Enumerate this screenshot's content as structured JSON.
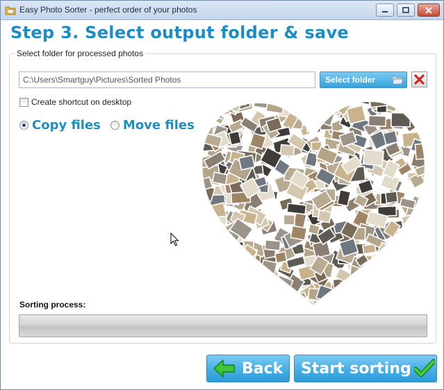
{
  "window": {
    "title": "Easy Photo Sorter - perfect order of your photos"
  },
  "step": {
    "heading": "Step 3. Select output folder & save"
  },
  "output_group": {
    "legend": "Select folder for processed photos",
    "folder_path": "C:\\Users\\Smartguy\\Pictures\\Sorted Photos",
    "select_folder_label": "Select folder",
    "shortcut_label": "Create shortcut on desktop",
    "shortcut_checked": false,
    "mode_options": [
      "Copy files",
      "Move files"
    ],
    "selected_mode": "Copy files"
  },
  "progress": {
    "label": "Sorting process:",
    "value": 0
  },
  "buttons": {
    "back_label": "Back",
    "start_label": "Start sorting"
  },
  "colors": {
    "accent": "#1b8cc6",
    "button_blue": "#33a3dd",
    "close_red": "#c74a36"
  },
  "icons": {
    "app": "folder-photo-icon",
    "folder": "open-folder-icon",
    "clear": "red-x-icon",
    "back": "green-left-arrow-icon",
    "start": "green-checkmark-icon"
  }
}
